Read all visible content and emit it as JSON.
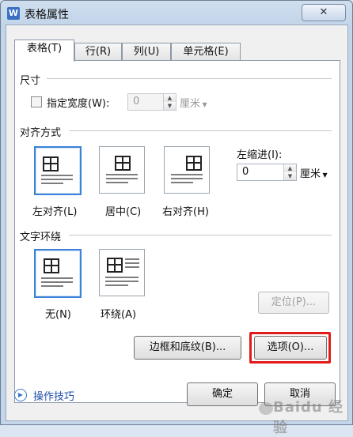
{
  "window": {
    "title": "表格属性",
    "close_symbol": "✕",
    "app_icon_letter": "W"
  },
  "tabs": [
    {
      "label": "表格(T)",
      "active": true
    },
    {
      "label": "行(R)",
      "active": false
    },
    {
      "label": "列(U)",
      "active": false
    },
    {
      "label": "单元格(E)",
      "active": false
    }
  ],
  "size_group": {
    "label": "尺寸",
    "width_checkbox_label": "指定宽度(W):",
    "width_checked": false,
    "width_value": "0",
    "unit": "厘米"
  },
  "alignment_group": {
    "label": "对齐方式",
    "options": [
      {
        "label": "左对齐(L)",
        "selected": true
      },
      {
        "label": "居中(C)",
        "selected": false
      },
      {
        "label": "右对齐(H)",
        "selected": false
      }
    ],
    "indent_label": "左缩进(I):",
    "indent_value": "0",
    "indent_unit": "厘米"
  },
  "wrap_group": {
    "label": "文字环绕",
    "options": [
      {
        "label": "无(N)",
        "selected": true
      },
      {
        "label": "环绕(A)",
        "selected": false
      }
    ],
    "position_button": "定位(P)..."
  },
  "buttons": {
    "borders_shading": "边框和底纹(B)...",
    "options": "选项(O)...",
    "ok": "确定",
    "cancel": "取消"
  },
  "tips_link": "操作技巧",
  "watermark": "Baidu 经验",
  "colors": {
    "accent_selected": "#3b82d6",
    "highlight_red": "#e11a1a",
    "link": "#1f4fa8"
  }
}
